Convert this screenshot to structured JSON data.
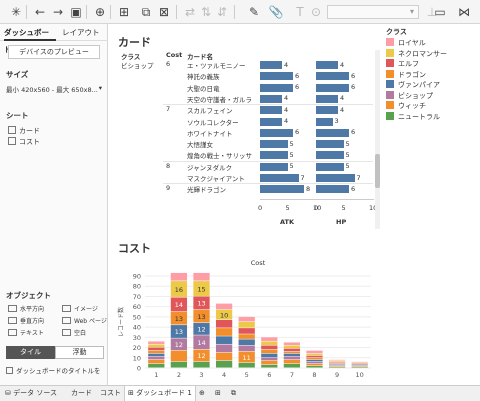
{
  "panel": {
    "tabs": [
      "ダッシュボード",
      "レイアウト"
    ],
    "preview_button": "デバイスのプレビュー",
    "size_heading": "サイズ",
    "size_value": "最小 420x560 - 最大 650x8...",
    "sheets_heading": "シート",
    "sheets": [
      "カード",
      "コスト"
    ],
    "objects_heading": "オブジェクト",
    "objects": [
      "水平方向",
      "イメージ",
      "垂直方向",
      "Web ページ",
      "テキスト",
      "空白"
    ],
    "tile_label": "タイル",
    "float_label": "浮動",
    "show_title_label": "ダッシュボードのタイトルを"
  },
  "card": {
    "title": "カード",
    "headers": {
      "class": "クラス",
      "cost": "Cost",
      "name": "カード名"
    },
    "class_value": "ビショップ",
    "cost_labels": [
      "6",
      "7",
      "8",
      "9"
    ],
    "rows": [
      {
        "name": "エ・ツァルモニノー",
        "atk": 4,
        "hp": 4
      },
      {
        "name": "神託の義族",
        "atk": 6,
        "hp": 6
      },
      {
        "name": "大聖の日竜",
        "atk": 6,
        "hp": 6
      },
      {
        "name": "天空の守護者・ガルラ",
        "atk": 4,
        "hp": 4
      },
      {
        "name": "スカルフェイン",
        "atk": 4,
        "hp": 4
      },
      {
        "name": "ソウルコレクター",
        "atk": 4,
        "hp": 3
      },
      {
        "name": "ホワイトナイト",
        "atk": 6,
        "hp": 6
      },
      {
        "name": "大悟謹女",
        "atk": 5,
        "hp": 5
      },
      {
        "name": "煌角の戦士・サリッサ",
        "atk": 5,
        "hp": 5
      },
      {
        "name": "ジャンヌダルク",
        "atk": 5,
        "hp": 5
      },
      {
        "name": "マスクジャイアント",
        "atk": 7,
        "hp": 7
      },
      {
        "name": "光輝ドラゴン",
        "atk": 8,
        "hp": 6
      }
    ],
    "axis_ticks": [
      "0",
      "5",
      "10"
    ],
    "axis_names": [
      "ATK",
      "HP"
    ]
  },
  "cost": {
    "title": "コスト"
  },
  "chart_data": {
    "type": "bar",
    "title": "Cost",
    "ylabel": "レコード数",
    "categories": [
      "1",
      "2",
      "3",
      "4",
      "5",
      "6",
      "7",
      "8",
      "9",
      "10"
    ],
    "ylim": [
      0,
      90
    ],
    "yticks": [
      0,
      10,
      20,
      30,
      40,
      50,
      60,
      70,
      80,
      90
    ],
    "series": [
      {
        "name": "ロイヤル",
        "values": [
          3,
          8,
          8,
          6,
          5,
          4,
          3,
          3,
          1,
          1
        ]
      },
      {
        "name": "ネクロマンサー",
        "values": [
          3,
          16,
          15,
          10,
          6,
          4,
          3,
          2,
          1,
          0
        ]
      },
      {
        "name": "エルフ",
        "values": [
          3,
          14,
          13,
          8,
          6,
          4,
          3,
          2,
          1,
          0
        ]
      },
      {
        "name": "ドラゴン",
        "values": [
          3,
          13,
          13,
          8,
          5,
          4,
          2,
          2,
          1,
          1
        ]
      },
      {
        "name": "ヴァンパイア",
        "values": [
          3,
          13,
          12,
          8,
          6,
          4,
          3,
          2,
          1,
          1
        ]
      },
      {
        "name": "ビショップ",
        "values": [
          3,
          12,
          14,
          8,
          6,
          3,
          3,
          2,
          1,
          1
        ]
      },
      {
        "name": "ウィッチ",
        "values": [
          4,
          11,
          12,
          8,
          11,
          4,
          4,
          2,
          1,
          1
        ]
      },
      {
        "name": "ニュートラル",
        "values": [
          4,
          6,
          6,
          7,
          5,
          3,
          4,
          2,
          1,
          1
        ]
      }
    ],
    "labels": [
      [
        null,
        null,
        null,
        null,
        null,
        null,
        null,
        null,
        null,
        null
      ],
      [
        null,
        16,
        15,
        10,
        null,
        null,
        null,
        null,
        null,
        null
      ],
      [
        null,
        14,
        13,
        null,
        null,
        null,
        null,
        null,
        null,
        null
      ],
      [
        null,
        13,
        13,
        null,
        null,
        null,
        null,
        null,
        null,
        null
      ],
      [
        null,
        13,
        12,
        null,
        null,
        null,
        null,
        null,
        null,
        null
      ],
      [
        null,
        12,
        14,
        null,
        null,
        null,
        null,
        null,
        null,
        null
      ],
      [
        null,
        null,
        12,
        null,
        11,
        null,
        null,
        null,
        null,
        null
      ],
      [
        null,
        null,
        null,
        null,
        null,
        null,
        null,
        null,
        null,
        null
      ]
    ]
  },
  "legend": {
    "title": "クラス",
    "items": [
      {
        "label": "ロイヤル",
        "color": "#ff9da7"
      },
      {
        "label": "ネクロマンサー",
        "color": "#edc948"
      },
      {
        "label": "エルフ",
        "color": "#e15759"
      },
      {
        "label": "ドラゴン",
        "color": "#f28e2b"
      },
      {
        "label": "ヴァンパイア",
        "color": "#4e79a7"
      },
      {
        "label": "ビショップ",
        "color": "#b07aa1"
      },
      {
        "label": "ウィッチ",
        "color": "#f28e2b"
      },
      {
        "label": "ニュートラル",
        "color": "#59a14f"
      }
    ]
  },
  "tabs": {
    "datasource": "データ ソース",
    "sheets": [
      "カード",
      "コスト",
      "ダッシュボード 1"
    ]
  }
}
